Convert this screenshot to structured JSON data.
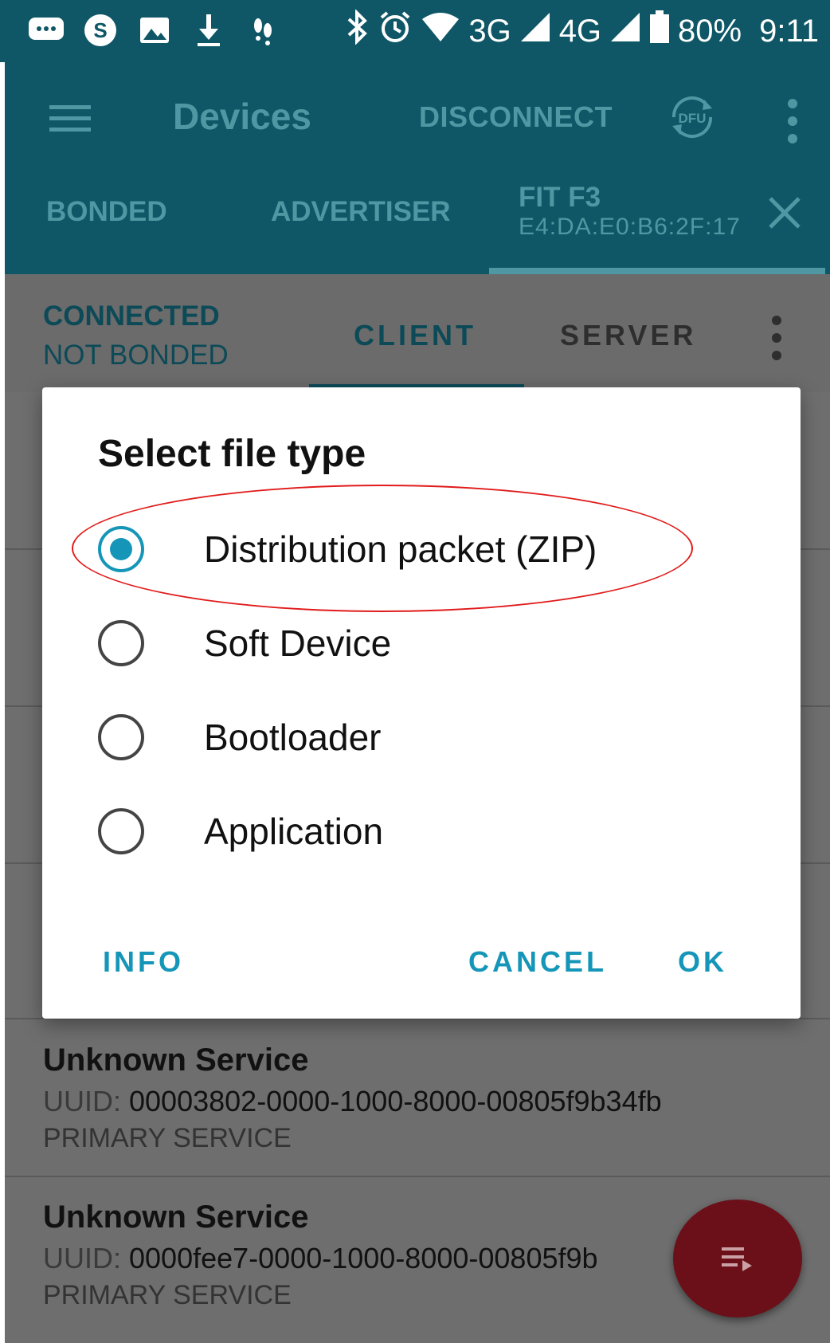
{
  "status_bar": {
    "network_3g": "3G",
    "network_4g": "4G",
    "battery": "80%",
    "time": "9:11"
  },
  "app_bar": {
    "title": "Devices",
    "disconnect": "DISCONNECT",
    "dfu": "DFU"
  },
  "tabs": {
    "bonded": "BONDED",
    "advertiser": "ADVERTISER",
    "device_name": "FIT F3",
    "device_address": "E4:DA:E0:B6:2F:17"
  },
  "device": {
    "connection_state": "CONNECTED",
    "bond_state": "NOT BONDED",
    "client_tab": "CLIENT",
    "server_tab": "SERVER"
  },
  "services": [
    {
      "name": "Unknown Service",
      "uuid_label": "UUID:",
      "uuid": "00003802-0000-1000-8000-00805f9b34fb",
      "type": "PRIMARY SERVICE"
    },
    {
      "name": "Unknown Service",
      "uuid_label": "UUID:",
      "uuid": "0000fee7-0000-1000-8000-00805f9b",
      "type": "PRIMARY SERVICE"
    }
  ],
  "dialog": {
    "title": "Select file type",
    "options": [
      {
        "label": "Distribution packet (ZIP)",
        "checked": true
      },
      {
        "label": "Soft Device",
        "checked": false
      },
      {
        "label": "Bootloader",
        "checked": false
      },
      {
        "label": "Application",
        "checked": false
      }
    ],
    "info": "INFO",
    "cancel": "CANCEL",
    "ok": "OK"
  },
  "colors": {
    "primary": "#0f5766",
    "accent": "#1596b8",
    "fab": "#6b1019",
    "highlight": "#e11b1b"
  }
}
